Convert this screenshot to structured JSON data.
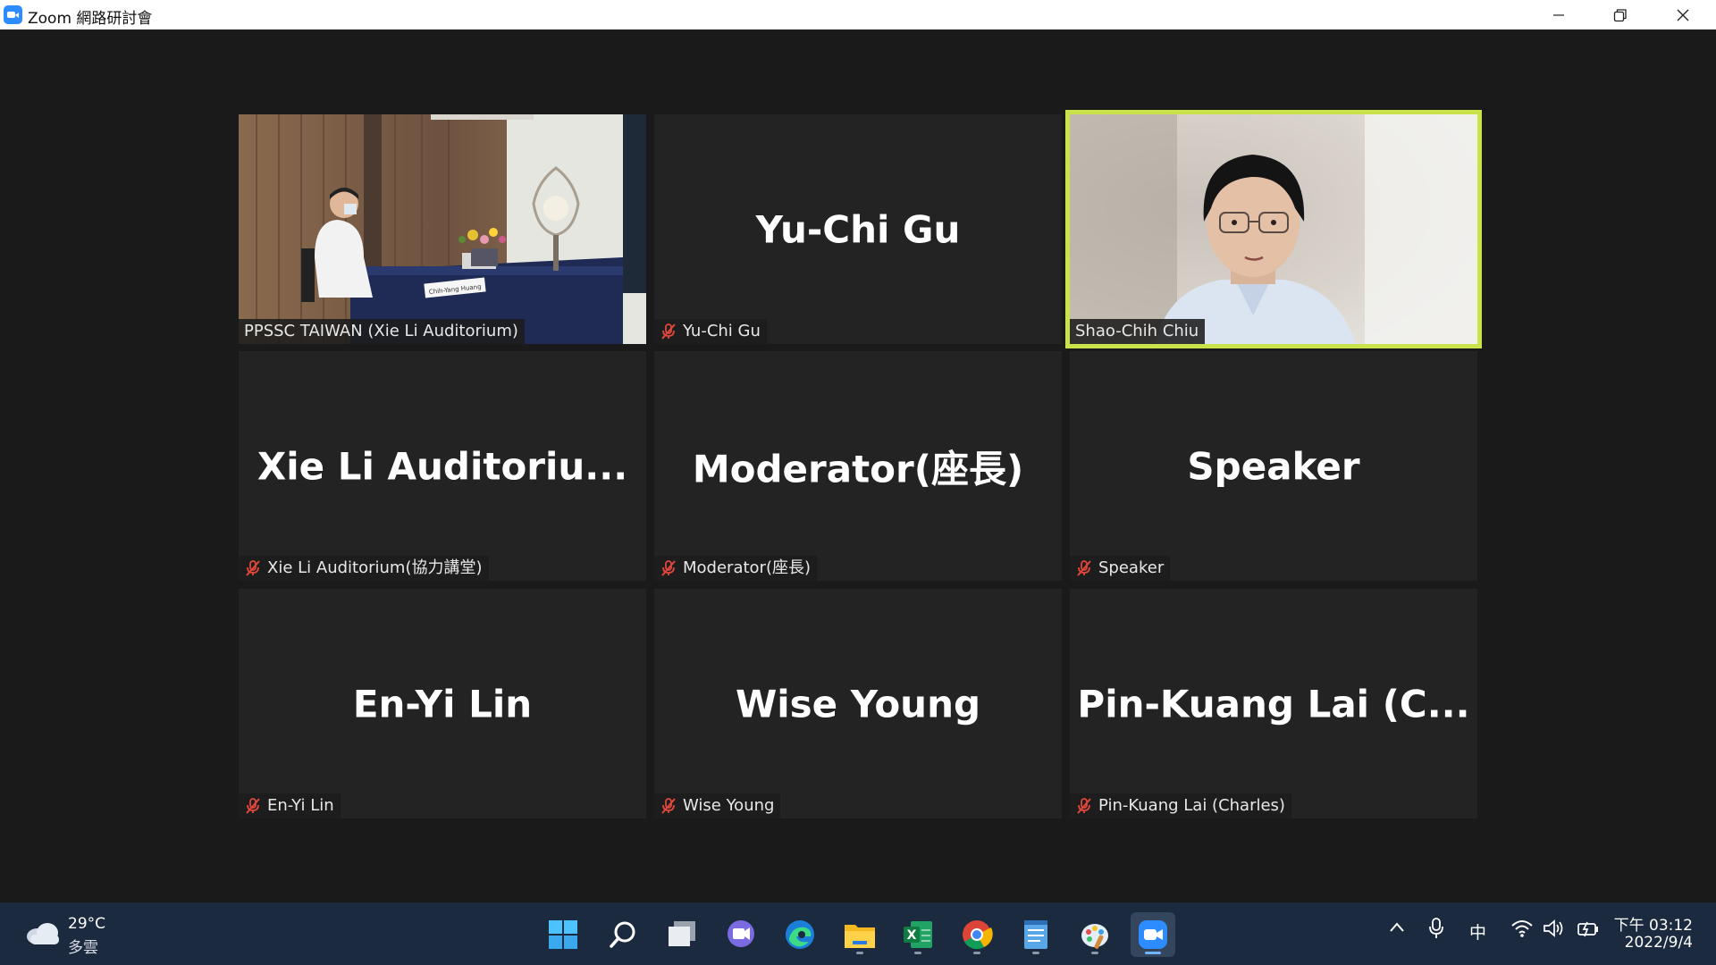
{
  "window": {
    "title": "Zoom 網路研討會"
  },
  "tiles": [
    {
      "name": "PPSSC TAIWAN (Xie Li Auditorium)",
      "video": true,
      "muted": false,
      "card_name": "Chih-Yang Huang"
    },
    {
      "big": "Yu-Chi Gu",
      "name": "Yu-Chi Gu",
      "muted": true
    },
    {
      "name": "Shao-Chih Chiu",
      "video": true,
      "muted": false,
      "active_speaker": true
    },
    {
      "big": "Xie  Li  Auditoriu...",
      "name": "Xie Li Auditorium(協力講堂)",
      "muted": true
    },
    {
      "big": "Moderator(座長)",
      "name": "Moderator(座長)",
      "muted": true
    },
    {
      "big": "Speaker",
      "name": "Speaker",
      "muted": true
    },
    {
      "big": "En-Yi Lin",
      "name": "En-Yi Lin",
      "muted": true
    },
    {
      "big": "Wise Young",
      "name": "Wise Young",
      "muted": true
    },
    {
      "big": "Pin-Kuang  Lai  (C...",
      "name": "Pin-Kuang Lai (Charles)",
      "muted": true
    }
  ],
  "colors": {
    "active_border": "#cbe34a",
    "mute_icon": "#e0473c",
    "zoom_blue": "#2d8cff"
  },
  "taskbar": {
    "weather": {
      "temp": "29°C",
      "desc": "多雲",
      "icon": "cloud-icon"
    },
    "apps": [
      "windows-start-icon",
      "search-icon",
      "task-view-icon",
      "chat-icon",
      "edge-icon",
      "file-explorer-icon",
      "excel-icon",
      "chrome-icon",
      "notepad-icon",
      "paint-icon",
      "zoom-icon"
    ],
    "ime": "中",
    "clock_time": "下午 03:12",
    "clock_date": "2022/9/4"
  }
}
